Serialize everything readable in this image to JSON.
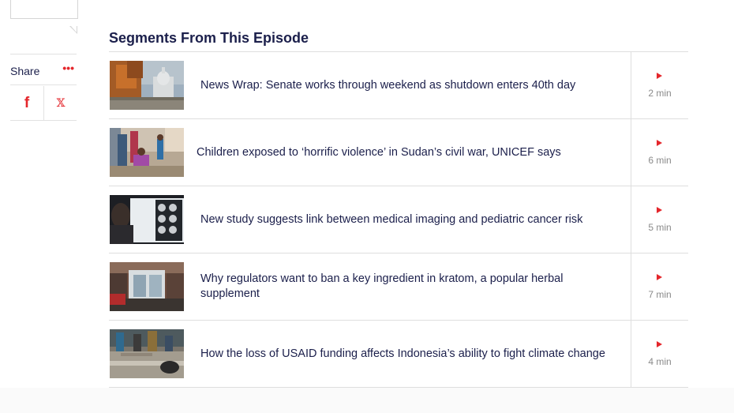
{
  "share": {
    "label": "Share",
    "more_icon": "more-dots-icon",
    "facebook_icon": "facebook-icon",
    "x_icon": "x-icon",
    "facebook_glyph": "f",
    "x_glyph": "𝕏"
  },
  "section": {
    "title": "Segments From This Episode"
  },
  "segments": [
    {
      "title": "News Wrap: Senate works through weekend as shutdown enters 40th day",
      "duration": "2 min",
      "thumb": "capitol-dome-autumn"
    },
    {
      "title": "Children exposed to ‘horrific violence’ in Sudan’s civil war, UNICEF says",
      "duration": "6 min",
      "thumb": "refugee-children"
    },
    {
      "title": "New study suggests link between medical imaging and pediatric cancer risk",
      "duration": "5 min",
      "thumb": "brain-scan-lightbox"
    },
    {
      "title": "Why regulators want to ban a key ingredient in kratom, a popular herbal supplement",
      "duration": "7 min",
      "thumb": "storefront"
    },
    {
      "title": "How the loss of USAID funding affects Indonesia’s ability to fight climate change",
      "duration": "4 min",
      "thumb": "flooded-street"
    }
  ],
  "colors": {
    "accent": "#e4262b",
    "text": "#1b1f4b",
    "muted": "#8a8a8a",
    "divider": "#dedede"
  }
}
